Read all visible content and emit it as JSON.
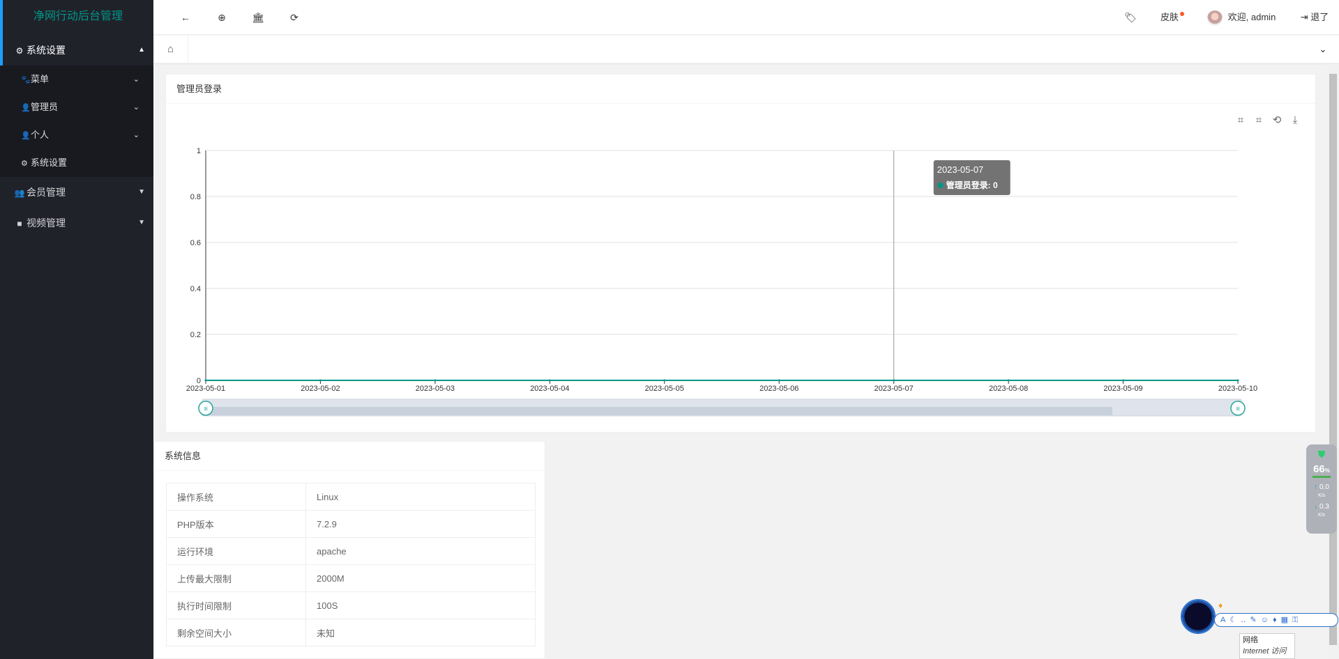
{
  "app": {
    "title": "净网行动后台管理"
  },
  "sidebar": {
    "groups": [
      {
        "label": "系统设置",
        "icon": "gear-icon",
        "expanded": true,
        "items": [
          {
            "label": "菜单",
            "icon": "paw-icon",
            "has_children": true
          },
          {
            "label": "管理员",
            "icon": "user-icon",
            "has_children": true
          },
          {
            "label": "个人",
            "icon": "user-icon",
            "has_children": true
          },
          {
            "label": "系统设置",
            "icon": "gear-icon",
            "has_children": false
          }
        ]
      },
      {
        "label": "会员管理",
        "icon": "users-icon",
        "expanded": false
      },
      {
        "label": "视频管理",
        "icon": "video-icon",
        "expanded": false
      }
    ]
  },
  "header": {
    "skin_label": "皮肤",
    "welcome": "欢迎, admin",
    "logout": "退了"
  },
  "chart_card": {
    "title": "管理员登录",
    "tooltip": {
      "date": "2023-05-07",
      "series": "管理员登录",
      "value": "0"
    }
  },
  "chart_data": {
    "type": "line",
    "title": "",
    "series": [
      {
        "name": "管理员登录",
        "values": [
          0,
          0,
          0,
          0,
          0,
          0,
          0,
          0,
          0,
          0
        ]
      }
    ],
    "x": [
      "2023-05-01",
      "2023-05-02",
      "2023-05-03",
      "2023-05-04",
      "2023-05-05",
      "2023-05-06",
      "2023-05-07",
      "2023-05-08",
      "2023-05-09",
      "2023-05-10"
    ],
    "y_ticks": [
      "0",
      "0.2",
      "0.4",
      "0.6",
      "0.8",
      "1"
    ],
    "ylim": [
      0,
      1
    ],
    "grid": true,
    "color": "#009688"
  },
  "system_info": {
    "title": "系统信息",
    "rows": [
      {
        "key": "操作系统",
        "value": "Linux"
      },
      {
        "key": "PHP版本",
        "value": "7.2.9"
      },
      {
        "key": "运行环境",
        "value": "apache"
      },
      {
        "key": "上传最大限制",
        "value": "2000M"
      },
      {
        "key": "执行时间限制",
        "value": "100S"
      },
      {
        "key": "剩余空间大小",
        "value": "未知"
      }
    ]
  },
  "monitor": {
    "percent": "66",
    "percent_unit": "%",
    "up": "0.0",
    "down": "0.3",
    "unit": "K/s"
  },
  "assistant": {
    "tip_line1": "网络",
    "tip_line2": "Internet 访问"
  }
}
